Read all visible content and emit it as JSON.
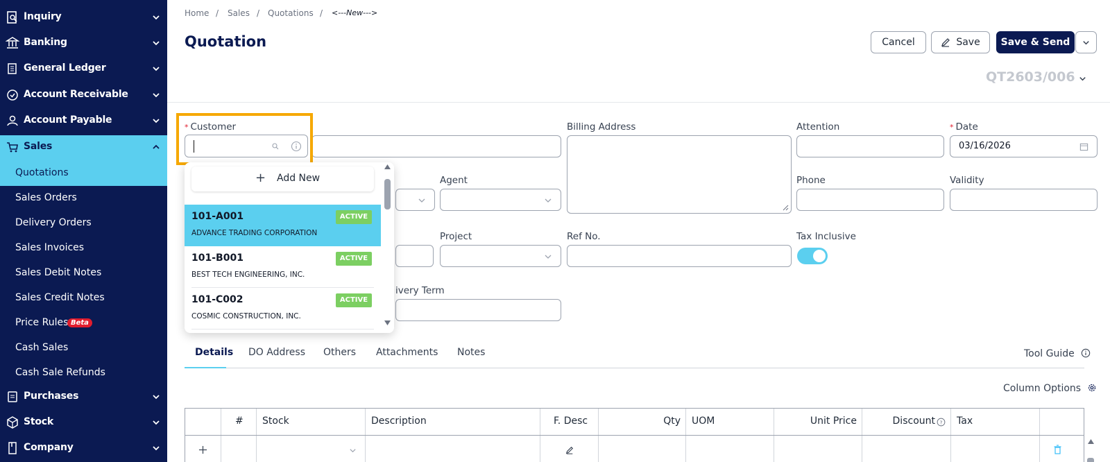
{
  "sidebar": {
    "items": [
      {
        "label": "Inquiry",
        "icon": "inquiry-icon"
      },
      {
        "label": "Banking",
        "icon": "bank-icon"
      },
      {
        "label": "General Ledger",
        "icon": "ledger-icon"
      },
      {
        "label": "Account Receivable",
        "icon": "receivable-icon"
      },
      {
        "label": "Account Payable",
        "icon": "payable-icon"
      },
      {
        "label": "Sales",
        "icon": "cart-icon"
      },
      {
        "label": "Purchases",
        "icon": "purchases-icon"
      },
      {
        "label": "Stock",
        "icon": "box-icon"
      },
      {
        "label": "Company",
        "icon": "company-icon"
      }
    ],
    "sales_sub": [
      {
        "label": "Quotations"
      },
      {
        "label": "Sales Orders"
      },
      {
        "label": "Delivery Orders"
      },
      {
        "label": "Sales Invoices"
      },
      {
        "label": "Sales Debit Notes"
      },
      {
        "label": "Sales Credit Notes"
      },
      {
        "label": "Price Rules",
        "badge": "Beta"
      },
      {
        "label": "Cash Sales"
      },
      {
        "label": "Cash Sale Refunds"
      }
    ]
  },
  "breadcrumb": {
    "home": "Home",
    "sales": "Sales",
    "quotations": "Quotations",
    "current": "<---New--->",
    "sep": "/"
  },
  "header": {
    "title": "Quotation",
    "cancel": "Cancel",
    "save": "Save",
    "save_send": "Save & Send",
    "doc_no": "QT2603/006"
  },
  "form": {
    "customer_label": "Customer",
    "billing_label": "Billing Address",
    "attention_label": "Attention",
    "date_label": "Date",
    "date_value": "03/16/2026",
    "agent_label": "Agent",
    "phone_label": "Phone",
    "validity_label": "Validity",
    "project_label": "Project",
    "ref_label": "Ref No.",
    "tax_label": "Tax Inclusive",
    "delivery_label": "ivery Term"
  },
  "customer_dropdown": {
    "add_new": "Add New",
    "options": [
      {
        "code": "101-A001",
        "name": "ADVANCE TRADING CORPORATION",
        "status": "ACTIVE"
      },
      {
        "code": "101-B001",
        "name": "BEST TECH ENGINEERING, INC.",
        "status": "ACTIVE"
      },
      {
        "code": "101-C002",
        "name": "COSMIC CONSTRUCTION, INC.",
        "status": "ACTIVE"
      }
    ]
  },
  "tabs": {
    "details": "Details",
    "do_address": "DO Address",
    "others": "Others",
    "attachments": "Attachments",
    "notes": "Notes",
    "tool_guide": "Tool Guide"
  },
  "table": {
    "column_options": "Column Options",
    "headers": {
      "num": "#",
      "stock": "Stock",
      "description": "Description",
      "fdesc": "F. Desc",
      "qty": "Qty",
      "uom": "UOM",
      "unit_price": "Unit Price",
      "discount": "Discount",
      "tax": "Tax"
    }
  },
  "colors": {
    "navy": "#0b1a52",
    "accent": "#5bcfef",
    "highlight": "#f6a800",
    "active_badge": "#7ccf62"
  }
}
